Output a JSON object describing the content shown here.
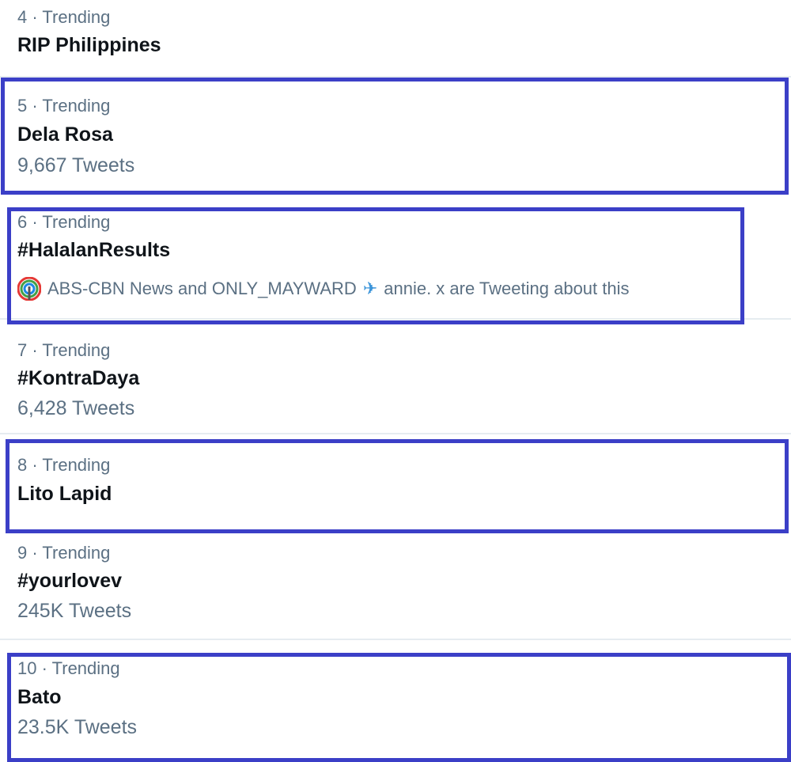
{
  "trends": [
    {
      "meta": "4 · Trending",
      "name": "RIP Philippines"
    },
    {
      "meta": "5 · Trending",
      "name": "Dela Rosa",
      "count": "9,667 Tweets"
    },
    {
      "meta": "6 · Trending",
      "name": "#HalalanResults",
      "context_before": "ABS-CBN News and ONLY_MAYWARD",
      "context_after": "annie. x are Tweeting about this"
    },
    {
      "meta": "7 · Trending",
      "name": "#KontraDaya",
      "count": "6,428 Tweets"
    },
    {
      "meta": "8 · Trending",
      "name": "Lito Lapid"
    },
    {
      "meta": "9 · Trending",
      "name": "#yourlovev",
      "count": "245K Tweets"
    },
    {
      "meta": "10 · Trending",
      "name": "Bato",
      "count": "23.5K Tweets"
    }
  ],
  "colors": {
    "highlight_border": "#3b3fc7",
    "secondary_text": "#5b7083",
    "primary_text": "#0f1419"
  },
  "icons": {
    "abs_cbn_logo": "abs-cbn-logo-icon",
    "airplane": "airplane-emoji-icon"
  }
}
